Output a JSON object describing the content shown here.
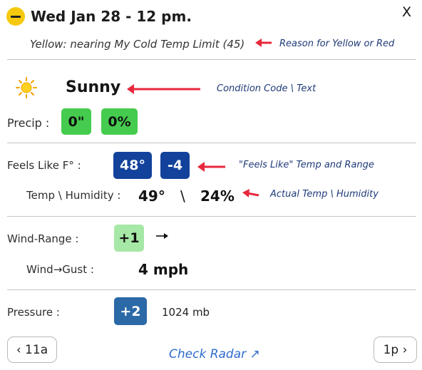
{
  "header": {
    "title": "Wed Jan 28 - 12 pm.",
    "close_label": "X",
    "reason": "Yellow: nearing My Cold Temp Limit (45)",
    "status_color": "#f6c90e"
  },
  "annotations": {
    "reason_note": "Reason for Yellow or Red",
    "condition_note": "Condition Code \\ Text",
    "feels_note": "\"Feels Like\" Temp and Range",
    "actual_note": "Actual Temp \\ Humidity",
    "arrow_color": "#e8283c"
  },
  "condition": {
    "icon": "sun-icon",
    "text": "Sunny"
  },
  "precip": {
    "label": "Precip :",
    "amount": "0\"",
    "chance": "0%"
  },
  "feels_like": {
    "label": "Feels Like F° :",
    "value": "48°",
    "range": "-4"
  },
  "temp_humidity": {
    "label": "Temp \\ Humidity :",
    "temp": "49°",
    "separator": "\\",
    "humidity": "24%"
  },
  "wind": {
    "range_label": "Wind-Range :",
    "range_value": "+1",
    "direction_icon": "arrow-right-icon",
    "gust_label": "Wind→Gust :",
    "gust_value": "4 mph"
  },
  "pressure": {
    "label": "Pressure :",
    "change": "+2",
    "value": "1024 mb"
  },
  "footer": {
    "prev_label": "‹ 11a",
    "radar_label": "Check Radar ↗",
    "next_label": "1p ›"
  }
}
